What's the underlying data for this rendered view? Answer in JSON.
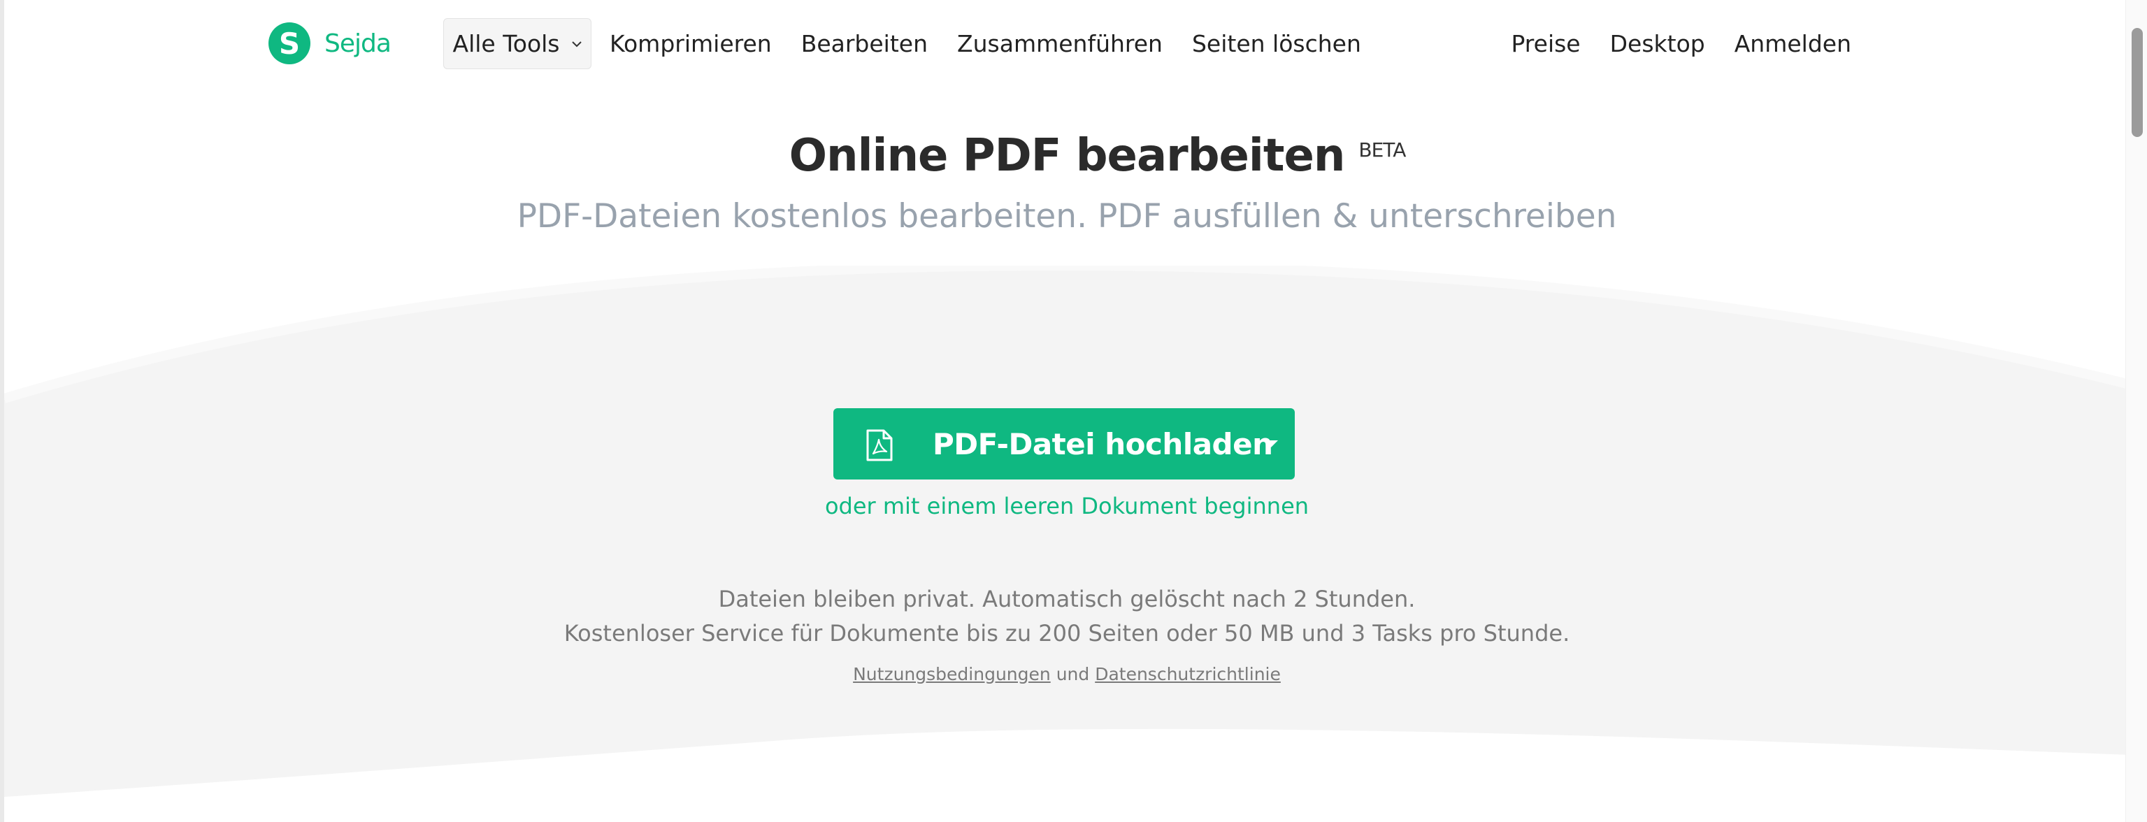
{
  "header": {
    "logo_letter": "S",
    "logo_text": "Sejda",
    "all_tools_label": "Alle Tools",
    "nav_links": [
      "Komprimieren",
      "Bearbeiten",
      "Zusammenführen",
      "Seiten löschen"
    ],
    "right_links": [
      "Preise",
      "Desktop",
      "Anmelden"
    ]
  },
  "hero": {
    "title": "Online PDF bearbeiten",
    "badge": "BETA",
    "subtitle": "PDF-Dateien kostenlos bearbeiten. PDF ausfüllen & unterschreiben"
  },
  "upload": {
    "button_label": "PDF-Datei hochladen",
    "blank_link": "oder mit einem leeren Dokument beginnen"
  },
  "info": {
    "line1": "Dateien bleiben privat. Automatisch gelöscht nach 2 Stunden.",
    "line2": "Kostenloser Service für Dokumente bis zu 200 Seiten oder 50 MB und 3 Tasks pro Stunde."
  },
  "legal": {
    "terms": "Nutzungsbedingungen",
    "connector": "und",
    "privacy": "Datenschutzrichtlinie"
  },
  "icons": {
    "logo": "sejda-logo-icon",
    "all_tools_chevron": "chevron-down-icon",
    "upload_file": "pdf-file-icon",
    "upload_dropdown": "caret-down-icon"
  },
  "colors": {
    "brand": "#0fb881",
    "band": "#f4f4f4",
    "subtitle": "#98a2ad",
    "muted_text": "#7a7a7a"
  }
}
